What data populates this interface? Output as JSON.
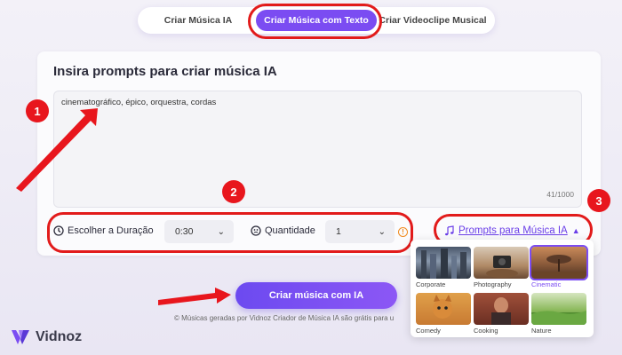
{
  "tabs": [
    {
      "label": "Criar Música IA",
      "active": false
    },
    {
      "label": "Criar Música com Texto",
      "active": true
    },
    {
      "label": "Criar Videoclipe Musical",
      "active": false
    }
  ],
  "card": {
    "title": "Insira prompts para criar música IA",
    "prompt_value": "cinematográfico, épico, orquestra, cordas",
    "char_count": "41/1000"
  },
  "options": {
    "duration_label": "Escolher a Duração",
    "duration_value": "0:30",
    "quantity_label": "Quantidade",
    "quantity_value": "1",
    "prompts_link": "Prompts para Música IA"
  },
  "badges": [
    "1",
    "2",
    "3"
  ],
  "generate_button": "Criar música com IA",
  "footnote": "Músicas geradas por Vidnoz Criador de Música IA são grátis para u",
  "logo": "Vidnoz",
  "dropdown": {
    "items": [
      {
        "label": "Corporate",
        "selected": false
      },
      {
        "label": "Photography",
        "selected": false
      },
      {
        "label": "Cinematic",
        "selected": true
      },
      {
        "label": "Comedy",
        "selected": false
      },
      {
        "label": "Cooking",
        "selected": false
      },
      {
        "label": "Nature",
        "selected": false
      }
    ]
  },
  "colors": {
    "accent": "#7b4cf2",
    "annotation_red": "#e21b1b",
    "warning_orange": "#f08a1e"
  }
}
